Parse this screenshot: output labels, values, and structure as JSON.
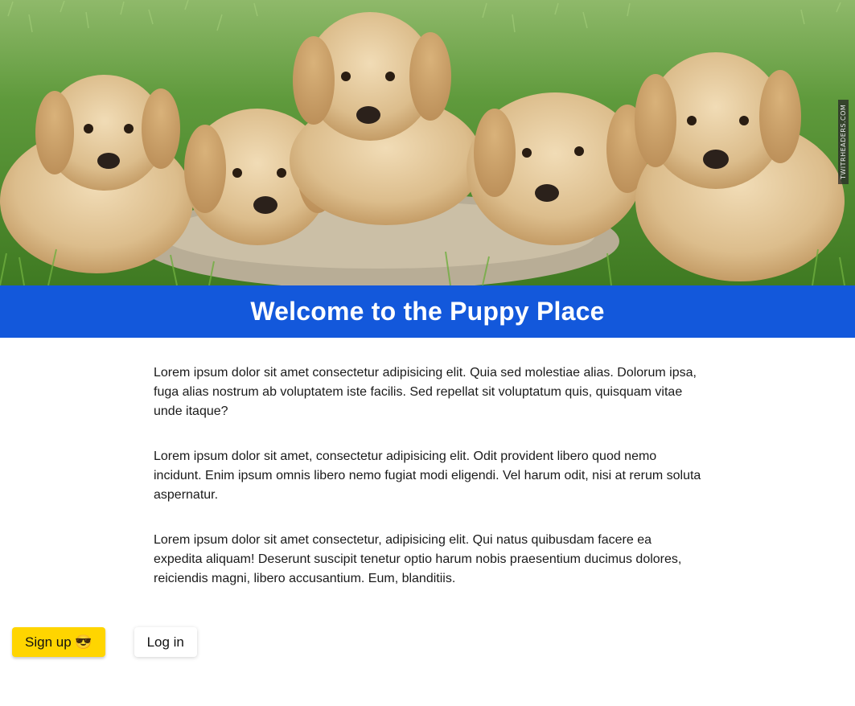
{
  "hero": {
    "watermark": "TWITRHEADERS.COM",
    "image_subject": "five labrador puppies lying on grass"
  },
  "banner": {
    "title": "Welcome to the Puppy Place",
    "background": "#1358db"
  },
  "content": {
    "paragraphs": [
      "Lorem ipsum dolor sit amet consectetur adipisicing elit. Quia sed molestiae alias. Dolorum ipsa, fuga alias nostrum ab voluptatem iste facilis. Sed repellat sit voluptatum quis, quisquam vitae unde itaque?",
      "Lorem ipsum dolor sit amet, consectetur adipisicing elit. Odit provident libero quod nemo incidunt. Enim ipsum omnis libero nemo fugiat modi eligendi. Vel harum odit, nisi at rerum soluta aspernatur.",
      "Lorem ipsum dolor sit amet consectetur, adipisicing elit. Qui natus quibusdam facere ea expedita aliquam! Deserunt suscipit tenetur optio harum nobis praesentium ducimus dolores, reiciendis magni, libero accusantium. Eum, blanditiis."
    ]
  },
  "actions": {
    "signup_label": "Sign up 😎",
    "login_label": "Log in",
    "signup_color": "#ffd500"
  }
}
